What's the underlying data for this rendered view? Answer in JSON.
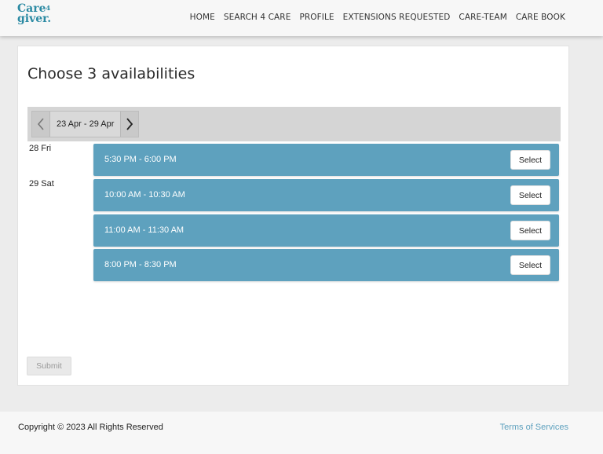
{
  "brand": {
    "logo_line1": "Care",
    "logo_sup": "4",
    "logo_line2": "giver.",
    "color": "#2b8aa3"
  },
  "nav": {
    "items": [
      "HOME",
      "SEARCH 4 CARE",
      "PROFILE",
      "EXTENSIONS REQUESTED",
      "CARE-TEAM",
      "CARE BOOK"
    ]
  },
  "main": {
    "title": "Choose 3 availabilities",
    "week": {
      "range": "23 Apr - 29 Apr",
      "prev_icon": "chevron-left-icon",
      "next_icon": "chevron-right-icon"
    },
    "days": [
      {
        "label": "28 Fri"
      },
      {
        "label": "29 Sat"
      }
    ],
    "slots": [
      {
        "time": "5:30 PM - 6:00 PM",
        "button": "Select"
      },
      {
        "time": "10:00 AM - 10:30 AM",
        "button": "Select"
      },
      {
        "time": "11:00 AM - 11:30 AM",
        "button": "Select"
      },
      {
        "time": "8:00 PM - 8:30 PM",
        "button": "Select"
      }
    ],
    "slot_color": "#5ea1be",
    "submit_label": "Submit"
  },
  "footer": {
    "copyright": "Copyright © 2023 All Rights Reserved",
    "terms": "Terms of Services"
  }
}
